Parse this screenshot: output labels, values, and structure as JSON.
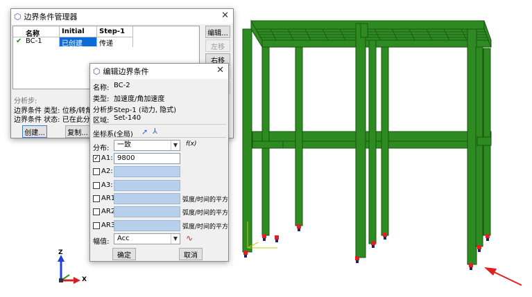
{
  "manager": {
    "title": "边界条件管理器",
    "columns": [
      "名称",
      "Initial",
      "Step-1"
    ],
    "rows": [
      {
        "check": "✔",
        "name": "BC-1",
        "initial": "已创建",
        "step1": "传递"
      }
    ],
    "buttons": {
      "edit": "编辑...",
      "move_left": "左移",
      "move_right": "右移"
    },
    "step_label": "分析步:",
    "bc_type_line": "边界条件 类型: 位移/转角",
    "bc_status_line": "边界条件 状态: 已在此分析步中",
    "bottom_buttons": {
      "create": "创建...",
      "copy": "复制..."
    }
  },
  "editor": {
    "title": "编辑边界条件",
    "name_label": "名称:",
    "name_value": "BC-2",
    "type_label": "类型:",
    "type_value": "加速度/角加速度",
    "step_label": "分析步:",
    "step_value": "Step-1 (动力, 隐式)",
    "region_label": "区域:",
    "region_value": "Set-140",
    "csys_label": "坐标系:",
    "csys_value": "(全局)",
    "dist_label": "分布:",
    "dist_value": "一致",
    "fx_label": "f(x)",
    "dofs": [
      {
        "label": "A1:",
        "checked": true,
        "value": "9800",
        "unit": ""
      },
      {
        "label": "A2:",
        "checked": false,
        "value": "",
        "unit": ""
      },
      {
        "label": "A3:",
        "checked": false,
        "value": "",
        "unit": ""
      },
      {
        "label": "AR1:",
        "checked": false,
        "value": "",
        "unit": "弧度/时间的平方"
      },
      {
        "label": "AR2:",
        "checked": false,
        "value": "",
        "unit": "弧度/时间的平方"
      },
      {
        "label": "AR3:",
        "checked": false,
        "value": "",
        "unit": "弧度/时间的平方"
      }
    ],
    "amp_label": "幅值:",
    "amp_value": "Acc",
    "ok": "确定",
    "cancel": "取消"
  },
  "triad": {
    "z": "Z",
    "x": "X"
  },
  "colors": {
    "frame": "#2e8b22",
    "arrow": "#e02020",
    "selection": "#0a6ad6",
    "field": "#b8d0ec"
  }
}
